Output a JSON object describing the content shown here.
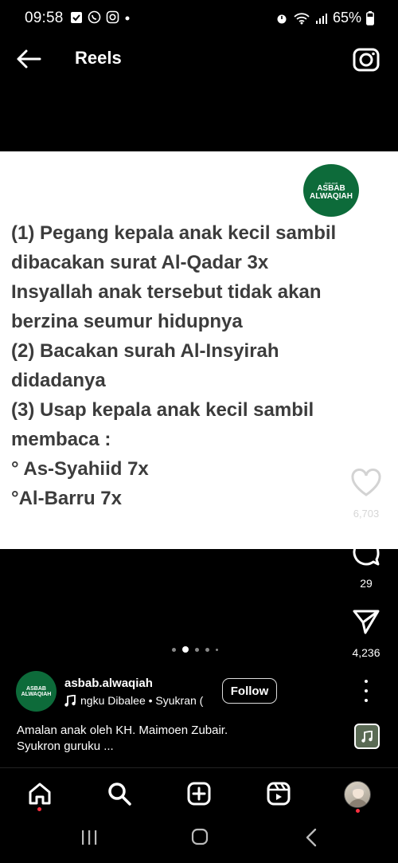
{
  "status_bar": {
    "time": "09:58",
    "battery": "65%",
    "left_icons": [
      "check-square-icon",
      "whatsapp-icon",
      "instagram-icon",
      "dot-icon"
    ],
    "right_icons": [
      "alarm-icon",
      "wifi-icon",
      "signal-icon",
      "battery-icon"
    ]
  },
  "header": {
    "title": "Reels"
  },
  "post": {
    "logo_small_text": "Ayat-ayat",
    "logo_text": "ASBAB\nALWAQIAH",
    "lines": [
      "(1) Pegang kepala anak kecil sambil",
      "dibacakan surat Al-Qadar 3x",
      "Insyallah anak tersebut tidak akan",
      "berzina seumur hidupnya",
      "(2) Bacakan surah Al-Insyirah",
      "didadanya",
      "(3) Usap kepala anak kecil sambil",
      "membaca :",
      "° As-Syahiid 7x",
      "°Al-Barru 7x"
    ]
  },
  "actions": {
    "like_count": "6,703",
    "comment_count": "29",
    "share_count": "4,236"
  },
  "carousel": {
    "total": 5,
    "active_index": 1
  },
  "author": {
    "avatar_text": "ASBAB\nALWAQIAH",
    "username": "asbab.alwaqiah",
    "music": "ngku Dibalee • Syukran (",
    "follow_label": "Follow",
    "caption_line1": "Amalan anak oleh KH. Maimoen Zubair.",
    "caption_line2": "Syukron guruku ..."
  },
  "nav": {
    "items": [
      "home-icon",
      "search-icon",
      "create-icon",
      "reels-icon",
      "profile-avatar"
    ]
  },
  "colors": {
    "brand_green": "#0d6b3a",
    "notification_red": "#ff3040",
    "text_gray": "#3c3c3c"
  }
}
